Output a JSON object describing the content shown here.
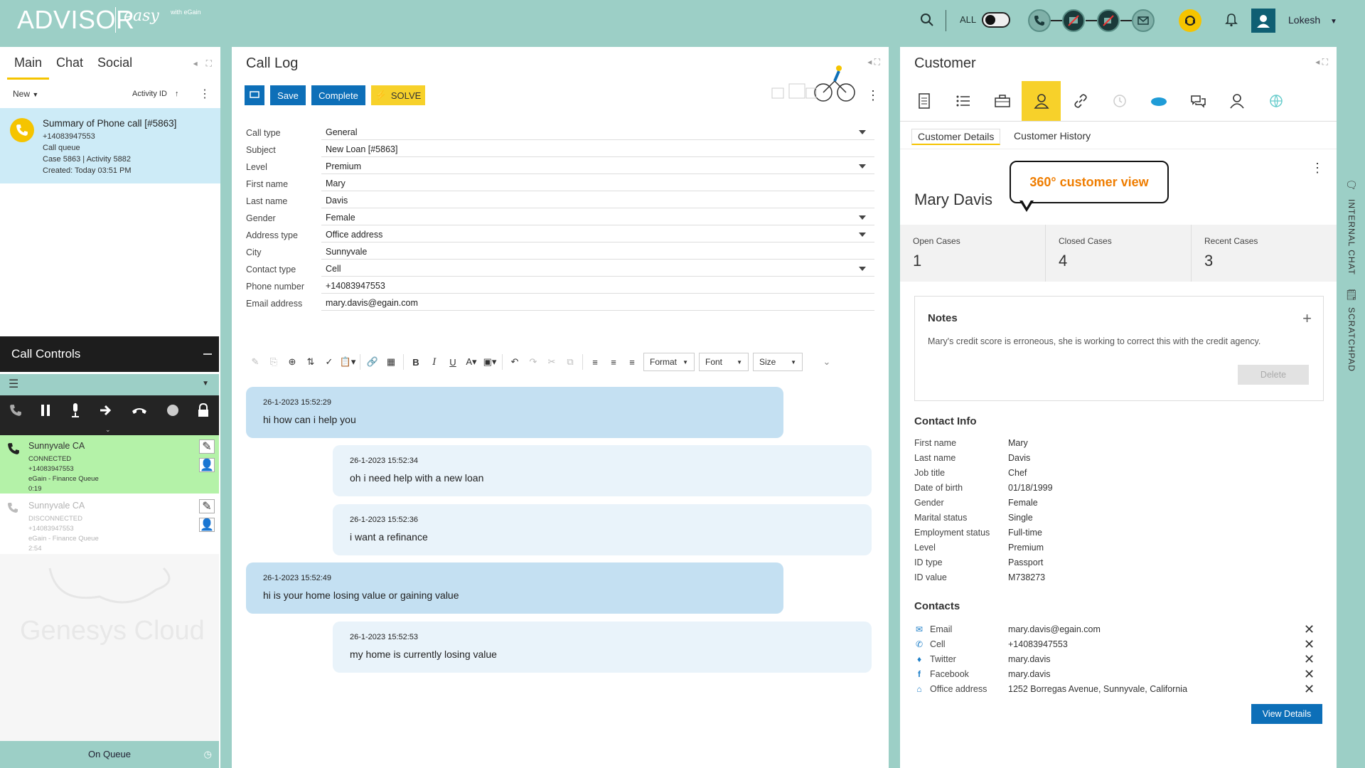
{
  "header": {
    "logo": "ADVISOR",
    "logo_sub": "easy",
    "logo_sub2": "with eGain",
    "all_label": "ALL",
    "user_name": "Lokesh"
  },
  "left": {
    "tabs": [
      "Main",
      "Chat",
      "Social"
    ],
    "filter_new": "New",
    "sort_label": "Activity ID",
    "activity": {
      "title": "Summary of Phone call [#5863]",
      "phone": "+14083947553",
      "queue": "Call queue",
      "case_activity": "Case 5863   |   Activity 5882",
      "created": "Created: Today 03:51 PM"
    },
    "call_controls_title": "Call Controls",
    "calls": [
      {
        "name": "Sunnyvale CA",
        "status": "CONNECTED",
        "phone": "+14083947553",
        "queue": "eGain - Finance Queue",
        "time": "0:19"
      },
      {
        "name": "Sunnyvale CA",
        "status": "DISCONNECTED",
        "phone": "+14083947553",
        "queue": "eGain - Finance Queue",
        "time": "2:54"
      }
    ],
    "watermark": "Genesys Cloud",
    "on_queue": "On Queue"
  },
  "mid": {
    "title": "Call Log",
    "buttons": {
      "save": "Save",
      "complete": "Complete",
      "solve": "SOLVE"
    },
    "form": [
      {
        "label": "Call type",
        "value": "General"
      },
      {
        "label": "Subject",
        "value": "New Loan [#5863]"
      },
      {
        "label": "Level",
        "value": "Premium"
      },
      {
        "label": "First name",
        "value": "Mary"
      },
      {
        "label": "Last name",
        "value": "Davis"
      },
      {
        "label": "Gender",
        "value": "Female"
      },
      {
        "label": "Address type",
        "value": "Office address"
      },
      {
        "label": "City",
        "value": "Sunnyvale"
      },
      {
        "label": "Contact type",
        "value": "Cell"
      },
      {
        "label": "Phone number",
        "value": "+14083947553"
      },
      {
        "label": "Email address",
        "value": "mary.davis@egain.com"
      }
    ],
    "editor": {
      "format": "Format",
      "font": "Font",
      "size": "Size"
    },
    "chat": [
      {
        "time": "26-1-2023 15:52:29",
        "text": "hi how can i help you"
      },
      {
        "time": "26-1-2023 15:52:34",
        "text": "oh i need help with a new loan"
      },
      {
        "time": "26-1-2023 15:52:36",
        "text": "i want a refinance"
      },
      {
        "time": "26-1-2023 15:52:49",
        "text": "hi is your home losing value or gaining value"
      },
      {
        "time": "26-1-2023 15:52:53",
        "text": "my home is currently losing value"
      }
    ]
  },
  "right": {
    "title": "Customer",
    "subtabs": [
      "Customer Details",
      "Customer History"
    ],
    "name": "Mary Davis",
    "callout": "360° customer view",
    "stats": [
      {
        "label": "Open Cases",
        "value": "1"
      },
      {
        "label": "Closed Cases",
        "value": "4"
      },
      {
        "label": "Recent Cases",
        "value": "3"
      }
    ],
    "notes": {
      "title": "Notes",
      "text": "Mary's credit score is erroneous, she is working to correct this with the credit agency.",
      "delete": "Delete"
    },
    "contact_info_title": "Contact Info",
    "contact_info": [
      {
        "k": "First name",
        "v": "Mary"
      },
      {
        "k": "Last name",
        "v": "Davis"
      },
      {
        "k": "Job title",
        "v": "Chef"
      },
      {
        "k": "Date of birth",
        "v": "01/18/1999"
      },
      {
        "k": "Gender",
        "v": "Female"
      },
      {
        "k": "Marital status",
        "v": "Single"
      },
      {
        "k": "Employment status",
        "v": "Full-time"
      },
      {
        "k": "Level",
        "v": "Premium"
      },
      {
        "k": "ID type",
        "v": "Passport"
      },
      {
        "k": "ID value",
        "v": "M738273"
      }
    ],
    "contacts_title": "Contacts",
    "contacts": [
      {
        "k": "Email",
        "v": "mary.davis@egain.com",
        "icon": "email-icon"
      },
      {
        "k": "Cell",
        "v": "+14083947553",
        "icon": "phone-icon"
      },
      {
        "k": "Twitter",
        "v": "mary.davis",
        "icon": "twitter-icon"
      },
      {
        "k": "Facebook",
        "v": "mary.davis",
        "icon": "facebook-icon"
      },
      {
        "k": "Office address",
        "v": "1252 Borregas Avenue, Sunnyvale, California",
        "icon": "home-icon"
      }
    ],
    "view_details": "View Details"
  },
  "side": {
    "internal_chat": "INTERNAL CHAT",
    "scratchpad": "SCRATCHPAD"
  }
}
